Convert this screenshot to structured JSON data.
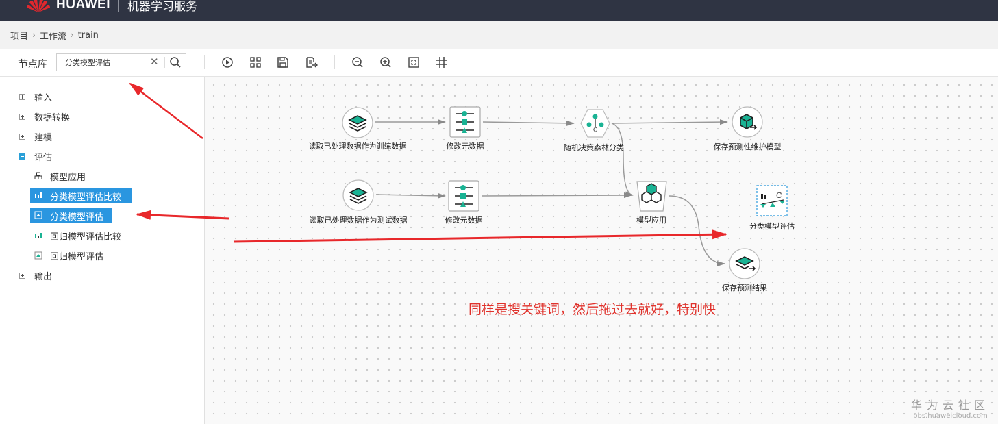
{
  "header": {
    "brand": "HUAWEI",
    "product": "机器学习服务"
  },
  "breadcrumb": {
    "items": [
      "项目",
      "工作流",
      "train"
    ]
  },
  "toolbar": {
    "library_label": "节点库",
    "search_value": "分类模型评估",
    "buttons": [
      "run-icon",
      "layout-icon",
      "save-icon",
      "export-icon",
      "zoom-out-icon",
      "zoom-in-icon",
      "fit-icon",
      "grid-icon"
    ]
  },
  "sidebar": {
    "groups": [
      {
        "label": "输入",
        "expanded": false
      },
      {
        "label": "数据转换",
        "expanded": false
      },
      {
        "label": "建模",
        "expanded": false
      },
      {
        "label": "评估",
        "expanded": true
      },
      {
        "label": "输出",
        "expanded": false
      }
    ],
    "eval_children": [
      {
        "label": "模型应用",
        "highlighted": false
      },
      {
        "label": "分类模型评估比较",
        "highlighted": true
      },
      {
        "label": "分类模型评估",
        "highlighted": true
      },
      {
        "label": "回归模型评估比较",
        "highlighted": false
      },
      {
        "label": "回归模型评估",
        "highlighted": false
      }
    ]
  },
  "canvas": {
    "nodes": [
      {
        "id": "read-train",
        "label": "读取已处理数据作为训练数据"
      },
      {
        "id": "modify-meta-1",
        "label": "修改元数据"
      },
      {
        "id": "random-forest",
        "label": "随机决策森林分类"
      },
      {
        "id": "save-model",
        "label": "保存预测性维护模型"
      },
      {
        "id": "read-test",
        "label": "读取已处理数据作为测试数据"
      },
      {
        "id": "modify-meta-2",
        "label": "修改元数据"
      },
      {
        "id": "model-apply",
        "label": "模型应用"
      },
      {
        "id": "class-eval",
        "label": "分类模型评估"
      },
      {
        "id": "save-result",
        "label": "保存预测结果"
      }
    ]
  },
  "annotation": {
    "text": "同样是搜关键词，然后拖过去就好，特别快"
  },
  "watermark": {
    "title": "华为云社区",
    "url": "bbs.huaweicloud.com"
  },
  "colors": {
    "topbar": "#2f3443",
    "accent": "#2a96e0",
    "teal": "#1ab394",
    "annotation": "#e0322c"
  }
}
